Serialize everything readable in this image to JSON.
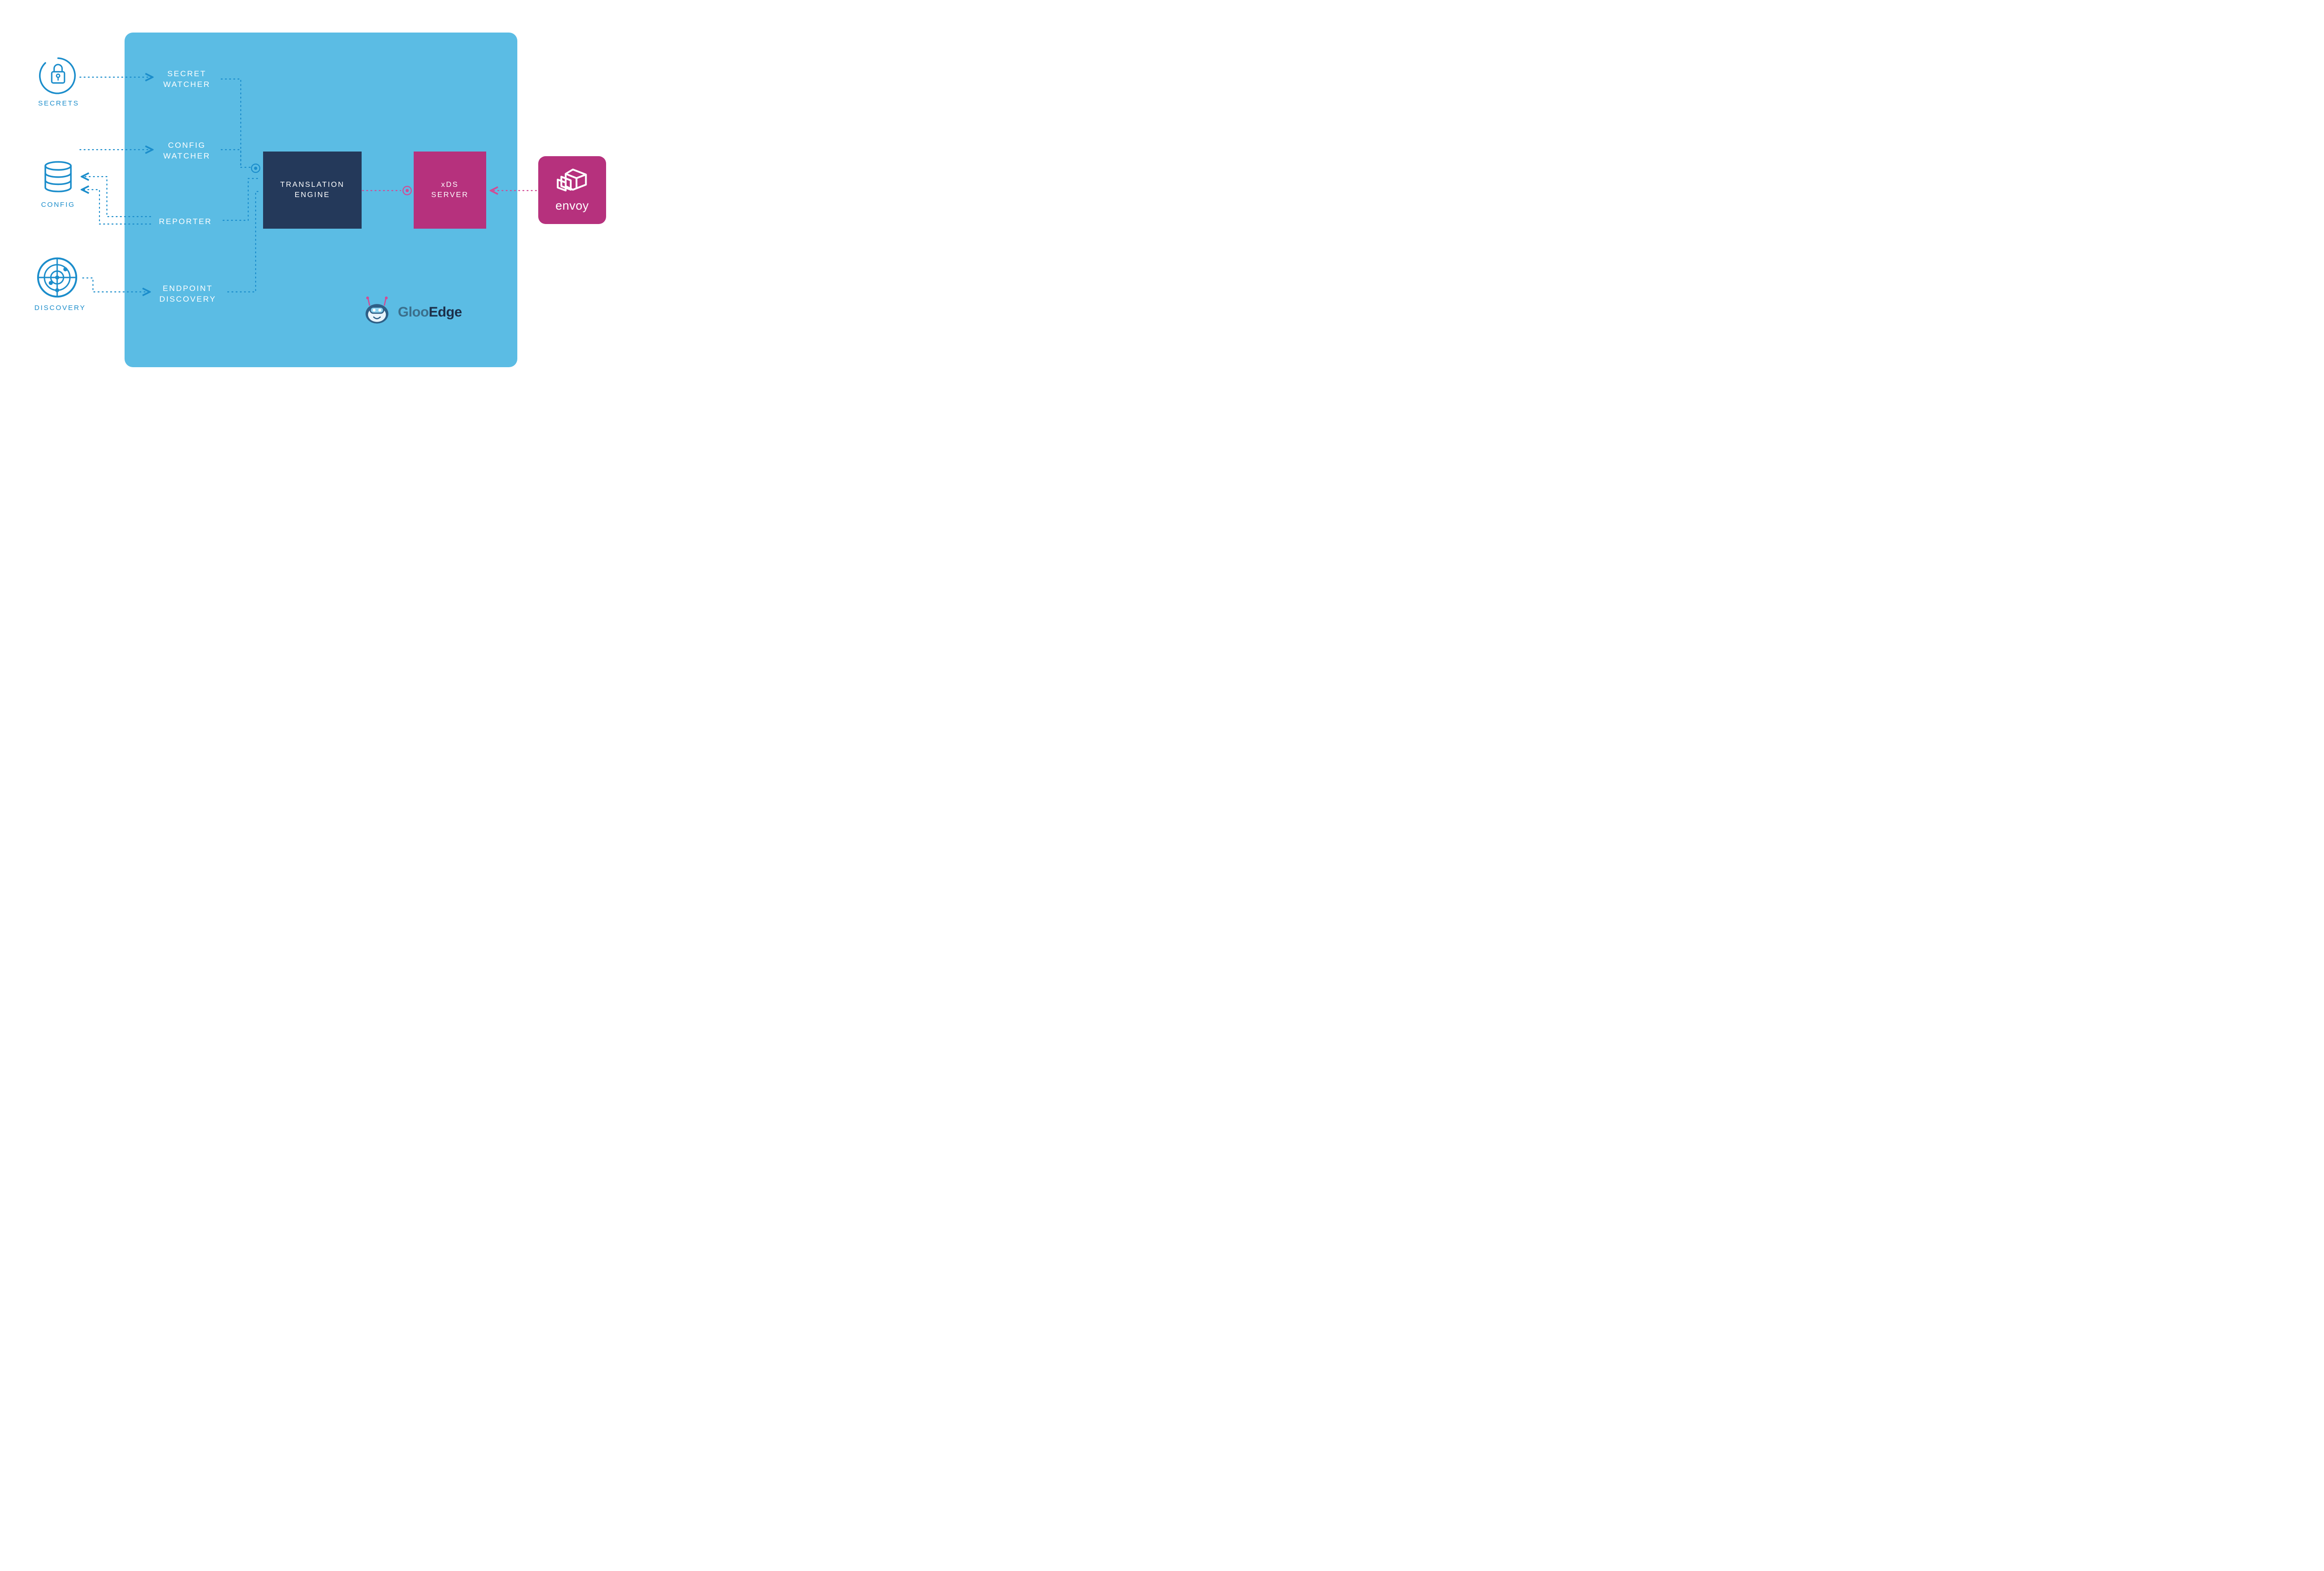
{
  "external": {
    "secrets": {
      "label": "SECRETS"
    },
    "config": {
      "label": "CONFIG"
    },
    "discovery": {
      "label": "DISCOVERY"
    }
  },
  "components": {
    "secret_watcher": {
      "line1": "SECRET",
      "line2": "WATCHER"
    },
    "config_watcher": {
      "line1": "CONFIG",
      "line2": "WATCHER"
    },
    "reporter": {
      "label": "REPORTER"
    },
    "endpoint_discovery": {
      "line1": "ENDPOINT",
      "line2": "DISCOVERY"
    },
    "translation_engine": {
      "line1": "TRANSLATION",
      "line2": "ENGINE"
    },
    "xds_server": {
      "line1": "xDS",
      "line2": "SERVER"
    }
  },
  "logos": {
    "gloo": {
      "part1": "Gloo",
      "part2": "Edge"
    },
    "envoy": {
      "label": "envoy"
    }
  },
  "colors": {
    "panel_bg": "#5BBCE4",
    "translation_bg": "#24395A",
    "magenta": "#B6317D",
    "blue_line": "#1B8DCB",
    "magenta_line": "#D24B95",
    "white": "#FFFFFF"
  }
}
